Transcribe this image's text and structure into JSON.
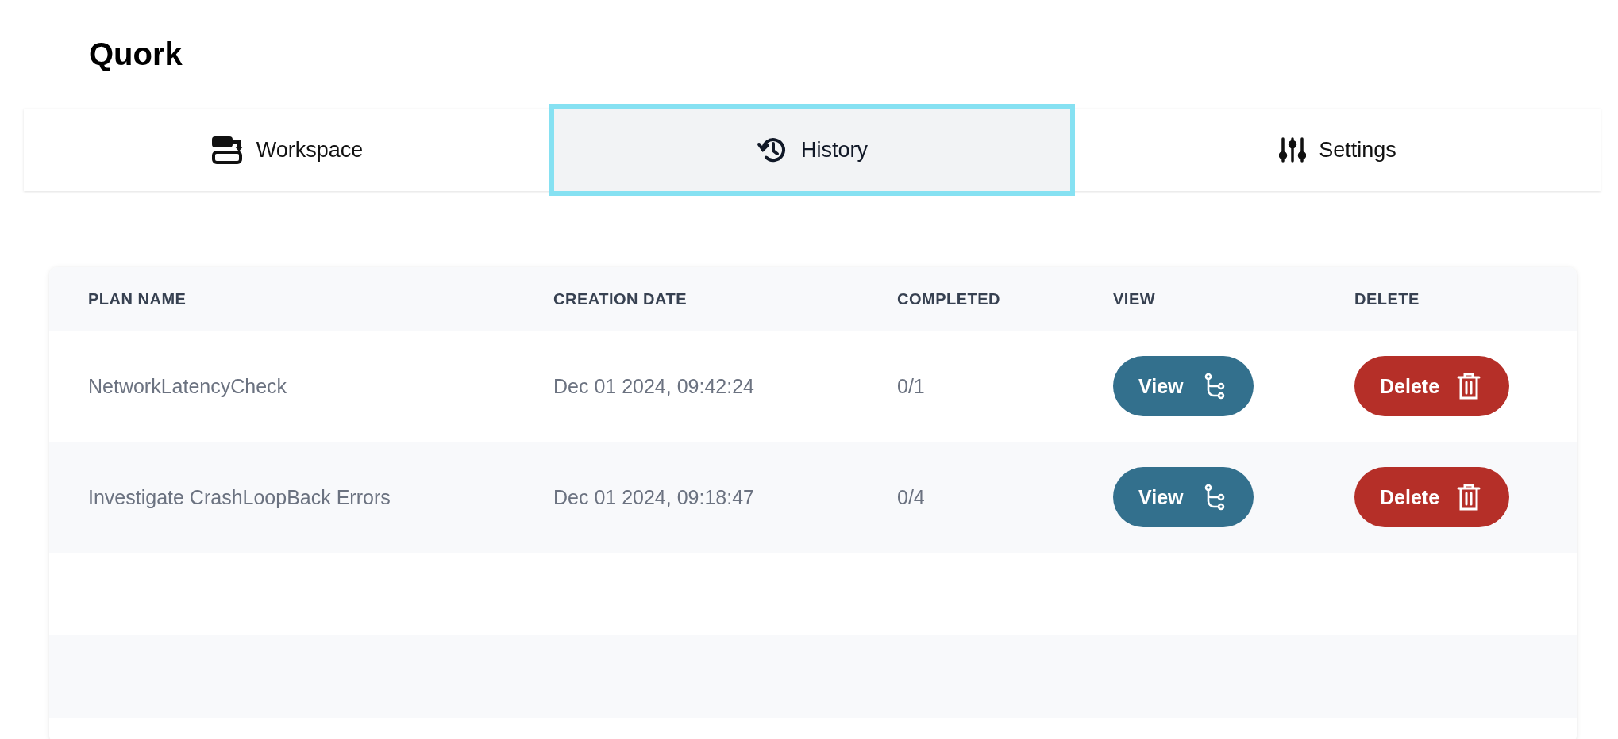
{
  "app": {
    "title": "Quork"
  },
  "tabs": [
    {
      "label": "Workspace",
      "kind": "workspace",
      "selected": false
    },
    {
      "label": "History",
      "kind": "history",
      "selected": true
    },
    {
      "label": "Settings",
      "kind": "settings",
      "selected": false
    }
  ],
  "table": {
    "columns": [
      "PLAN NAME",
      "CREATION DATE",
      "COMPLETED",
      "VIEW",
      "DELETE"
    ],
    "rows": [
      {
        "plan_name": "NetworkLatencyCheck",
        "creation_date": "Dec 01 2024, 09:42:24",
        "completed": "0/1",
        "view": "View",
        "delete": "Delete"
      },
      {
        "plan_name": "Investigate CrashLoopBack Errors",
        "creation_date": "Dec 01 2024, 09:18:47",
        "completed": "0/4",
        "view": "View",
        "delete": "Delete"
      }
    ]
  }
}
